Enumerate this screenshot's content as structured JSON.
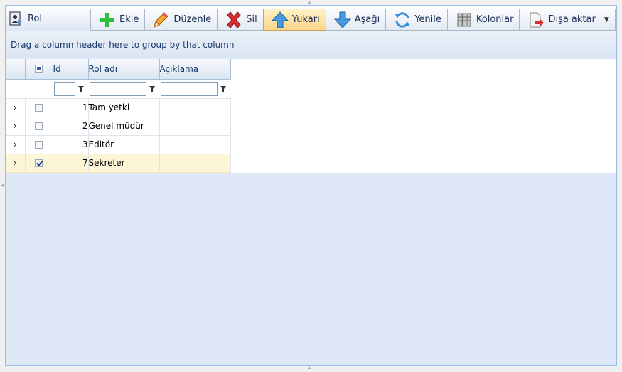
{
  "panel": {
    "title": "Rol"
  },
  "toolbar": {
    "buttons": [
      {
        "label": "Ekle",
        "icon": "add-icon",
        "color": "#2fbf3a"
      },
      {
        "label": "Düzenle",
        "icon": "pencil-icon",
        "color": "#e89a2c"
      },
      {
        "label": "Sil",
        "icon": "delete-icon",
        "color": "#d72f2f"
      },
      {
        "label": "Yukarı",
        "icon": "arrow-up-icon",
        "color": "#3a8fd8"
      },
      {
        "label": "Aşağı",
        "icon": "arrow-down-icon",
        "color": "#3a8fd8"
      },
      {
        "label": "Yenile",
        "icon": "refresh-icon",
        "color": "#3a8fd8"
      },
      {
        "label": "Kolonlar",
        "icon": "columns-icon",
        "color": "#888888"
      },
      {
        "label": "Dışa aktar",
        "icon": "export-icon",
        "color": "#d72f2f"
      }
    ]
  },
  "group_panel": {
    "hint": "Drag a column header here to group by that column"
  },
  "grid": {
    "columns": {
      "id": "Id",
      "name": "Rol adı",
      "desc": "Açıklama"
    },
    "rows": [
      {
        "id": "1",
        "name": "Tam yetki",
        "desc": "",
        "checked": false
      },
      {
        "id": "2",
        "name": "Genel müdür",
        "desc": "",
        "checked": false
      },
      {
        "id": "3",
        "name": "Editör",
        "desc": "",
        "checked": false
      },
      {
        "id": "7",
        "name": "Sekreter",
        "desc": "",
        "checked": true
      }
    ]
  }
}
